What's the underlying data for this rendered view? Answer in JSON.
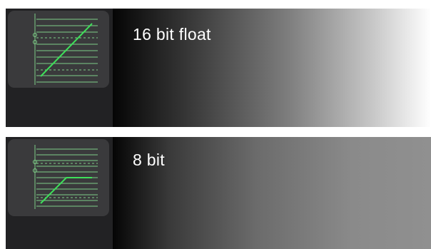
{
  "formats": [
    {
      "label": "16 bit float",
      "curve_icon": "linear-curve-icon"
    },
    {
      "label": "8 bit",
      "curve_icon": "clipped-curve-icon"
    }
  ],
  "colors": {
    "panel_bg": "#222224",
    "thumb_bg": "#3a3a3c",
    "curve_green": "#3ee05a",
    "grid_green": "#7fcf88",
    "label_text": "#ffffff"
  }
}
